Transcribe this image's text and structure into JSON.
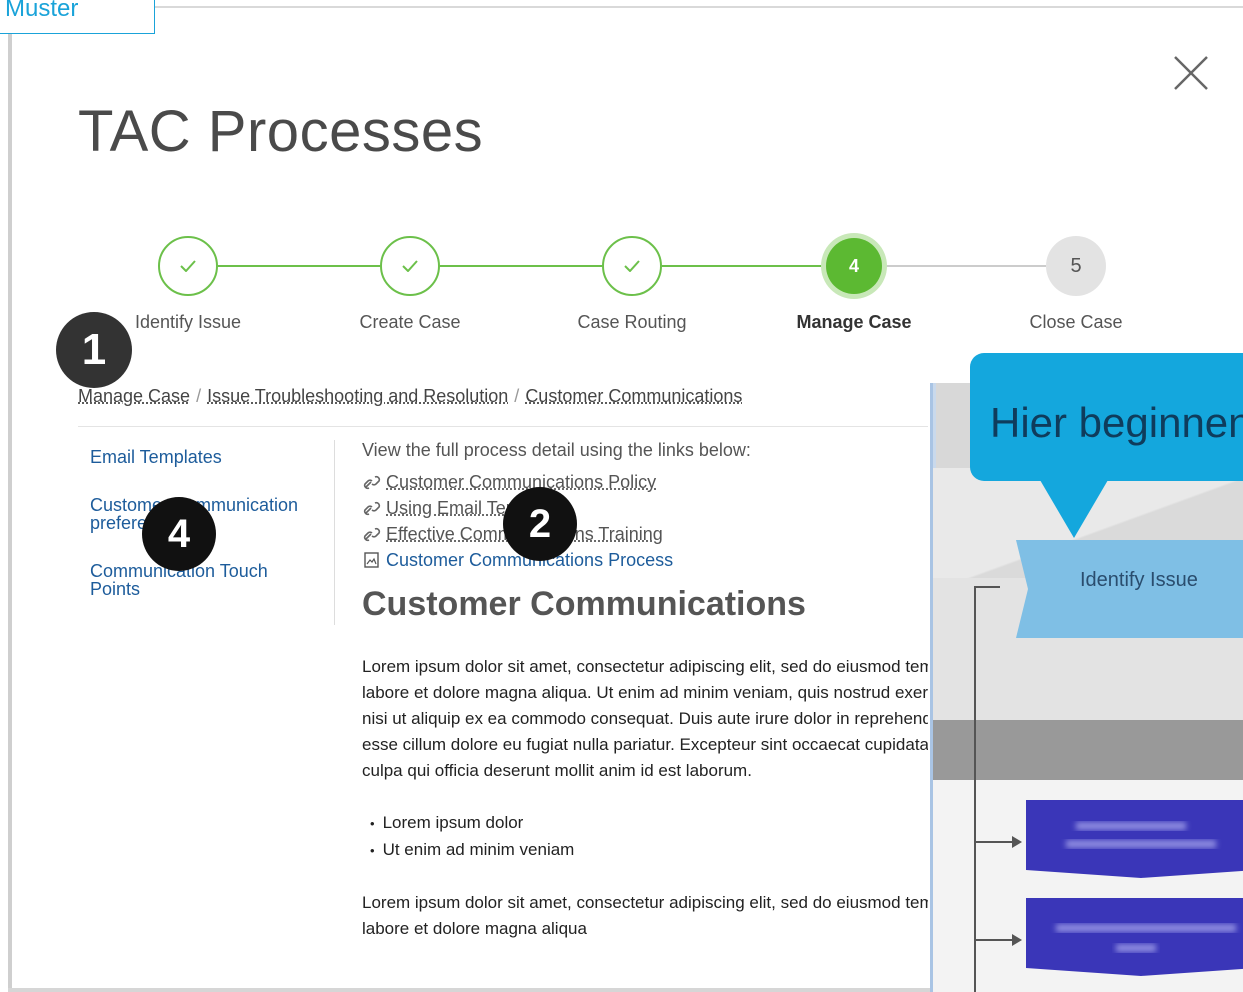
{
  "muster": "Muster",
  "page": {
    "title": "TAC Processes"
  },
  "stepper": {
    "steps": [
      {
        "label": "Identify Issue",
        "state": "done"
      },
      {
        "label": "Create Case",
        "state": "done"
      },
      {
        "label": "Case Routing",
        "state": "done"
      },
      {
        "label": "Manage Case",
        "state": "active",
        "number": "4"
      },
      {
        "label": "Close Case",
        "state": "todo",
        "number": "5"
      }
    ]
  },
  "badges": {
    "one": "1",
    "two": "2",
    "four": "4"
  },
  "breadcrumb": [
    "Manage Case",
    "Issue Troubleshooting and Resolution",
    "Customer Communications"
  ],
  "sidenav": [
    "Email Templates",
    "Customer Communication preferences",
    "Communication Touch Points"
  ],
  "main": {
    "intro": "View the full process detail using the links below:",
    "links": [
      "Customer Communications Policy",
      "Using Email Templates",
      "Effective Communications Training",
      "Customer Communications Process"
    ],
    "section_title": "Customer Communications",
    "para1": [
      "Lorem ipsum dolor sit amet, consectetur adipiscing elit, sed do eiusmod tempor incididunt ut",
      "labore et dolore magna aliqua. Ut enim ad minim veniam, quis nostrud exercitation ullamco laboris",
      "nisi ut aliquip ex ea commodo consequat. Duis aute irure dolor in reprehenderit in voluptate velit",
      "esse cillum dolore eu fugiat nulla pariatur. Excepteur sint occaecat cupidatat non proident, sunt in",
      "culpa qui officia deserunt mollit anim id est laborum."
    ],
    "bullets": [
      "Lorem ipsum dolor",
      "Ut enim ad minim veniam"
    ],
    "para2": [
      "Lorem ipsum dolor sit amet, consectetur adipiscing elit, sed do eiusmod tempor incididunt ut",
      "labore et dolore magna aliqua"
    ]
  },
  "diagram": {
    "identify_label": "Identify Issue"
  },
  "callout": {
    "text": "Hier beginnen"
  },
  "colors": {
    "accent": "#14a7dd",
    "success": "#5cb932",
    "link": "#1d5c9b"
  }
}
